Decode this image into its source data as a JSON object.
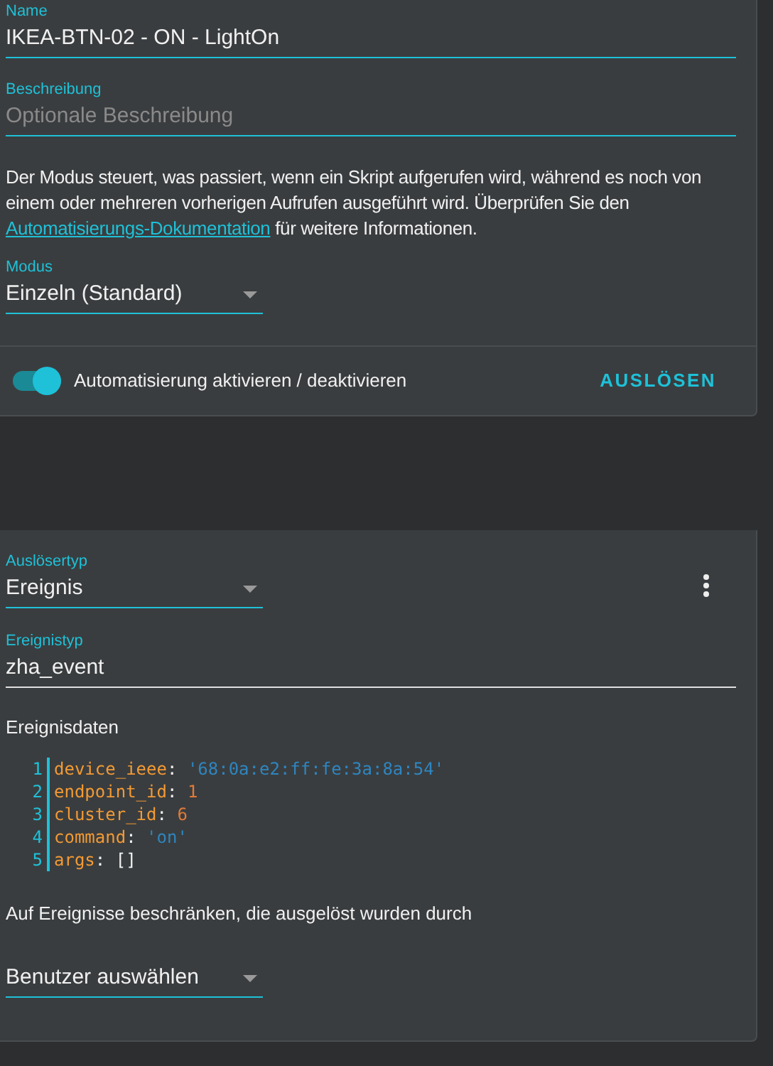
{
  "details_card": {
    "name_field": {
      "label": "Name",
      "value": "IKEA-BTN-02 - ON - LightOn"
    },
    "description_field": {
      "label": "Beschreibung",
      "placeholder": "Optionale Beschreibung"
    },
    "mode_help": {
      "before": "Der Modus steuert, was passiert, wenn ein Skript aufgerufen wird, während es noch von einem oder mehreren vorherigen Aufrufen ausgeführt wird. Überprüfen Sie den ",
      "link": "Automatisierungs-Dokumentation",
      "after": " für weitere Informationen."
    },
    "mode_select": {
      "label": "Modus",
      "value": "Einzeln (Standard)"
    },
    "enable_toggle": {
      "label": "Automatisierung aktivieren / deaktivieren",
      "on": true
    },
    "trigger_button": "AUSLÖSEN"
  },
  "trigger_card": {
    "type_select": {
      "label": "Auslösertyp",
      "value": "Ereignis"
    },
    "event_type_field": {
      "label": "Ereignistyp",
      "value": "zha_event"
    },
    "event_data_label": "Ereignisdaten",
    "code_lines": [
      {
        "number": "1",
        "tokens": [
          {
            "kind": "key",
            "text": "device_ieee"
          },
          {
            "kind": "plain",
            "text": ": "
          },
          {
            "kind": "string",
            "text": "'68:0a:e2:ff:fe:3a:8a:54'"
          }
        ]
      },
      {
        "number": "2",
        "tokens": [
          {
            "kind": "key",
            "text": "endpoint_id"
          },
          {
            "kind": "plain",
            "text": ": "
          },
          {
            "kind": "number",
            "text": "1"
          }
        ]
      },
      {
        "number": "3",
        "tokens": [
          {
            "kind": "key",
            "text": "cluster_id"
          },
          {
            "kind": "plain",
            "text": ": "
          },
          {
            "kind": "number",
            "text": "6"
          }
        ]
      },
      {
        "number": "4",
        "tokens": [
          {
            "kind": "key",
            "text": "command"
          },
          {
            "kind": "plain",
            "text": ": "
          },
          {
            "kind": "string",
            "text": "'on'"
          }
        ]
      },
      {
        "number": "5",
        "tokens": [
          {
            "kind": "key",
            "text": "args"
          },
          {
            "kind": "plain",
            "text": ": "
          },
          {
            "kind": "plain",
            "text": "[]"
          }
        ]
      }
    ],
    "restrict_label": "Auf Ereignisse beschränken, die ausgelöst wurden durch",
    "user_select": {
      "value": "Benutzer auswählen"
    }
  }
}
